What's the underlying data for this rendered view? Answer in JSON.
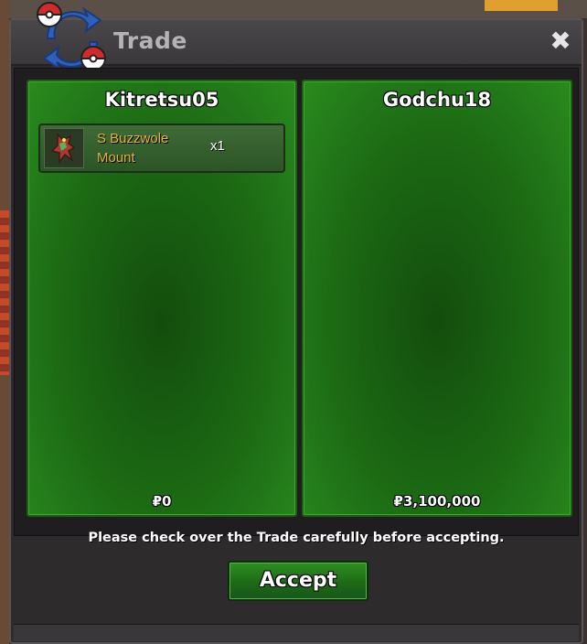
{
  "window": {
    "title": "Trade",
    "close_glyph": "✖"
  },
  "left_panel": {
    "player_name": "Kitretsu05",
    "items": [
      {
        "name": "S Buzzwole Mount",
        "quantity": "x1",
        "icon": "buzzwole-mount-icon"
      }
    ],
    "money": "₽0"
  },
  "right_panel": {
    "player_name": "Godchu18",
    "items": [],
    "money": "₽3,100,000"
  },
  "notice": "Please check over the Trade carefully before accepting.",
  "accept_label": "Accept",
  "colors": {
    "panel_green": "#1c6a14",
    "item_name_gold": "#e8b23a",
    "title_gray": "#b5b3b5"
  }
}
